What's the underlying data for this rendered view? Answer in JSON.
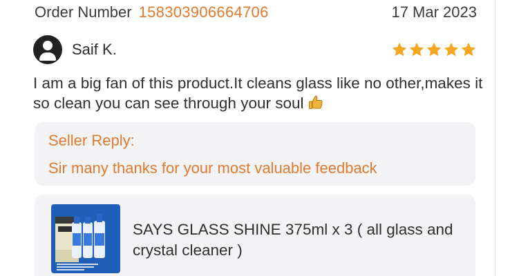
{
  "order": {
    "label": "Order Number",
    "number": "158303906664706",
    "date": "17 Mar 2023"
  },
  "reviewer": {
    "name": "Saif K.",
    "rating": 5,
    "rating_max": 5
  },
  "review": {
    "text": "I am a big fan of this product.It cleans glass like no other,makes it so clean you can see through your soul"
  },
  "seller_reply": {
    "title": "Seller Reply:",
    "text": "Sir many thanks for your most valuable feedback"
  },
  "product": {
    "title": "SAYS GLASS SHINE 375ml x 3 ( all glass and crystal cleaner )"
  },
  "colors": {
    "accent": "#e07a2e",
    "star": "#f5a623",
    "card_bg": "#f3f3f6",
    "product_bg": "#1f5fb8"
  },
  "icons": {
    "avatar": "user-avatar-icon",
    "star": "star-icon",
    "thumb": "thumbs-up-icon"
  }
}
